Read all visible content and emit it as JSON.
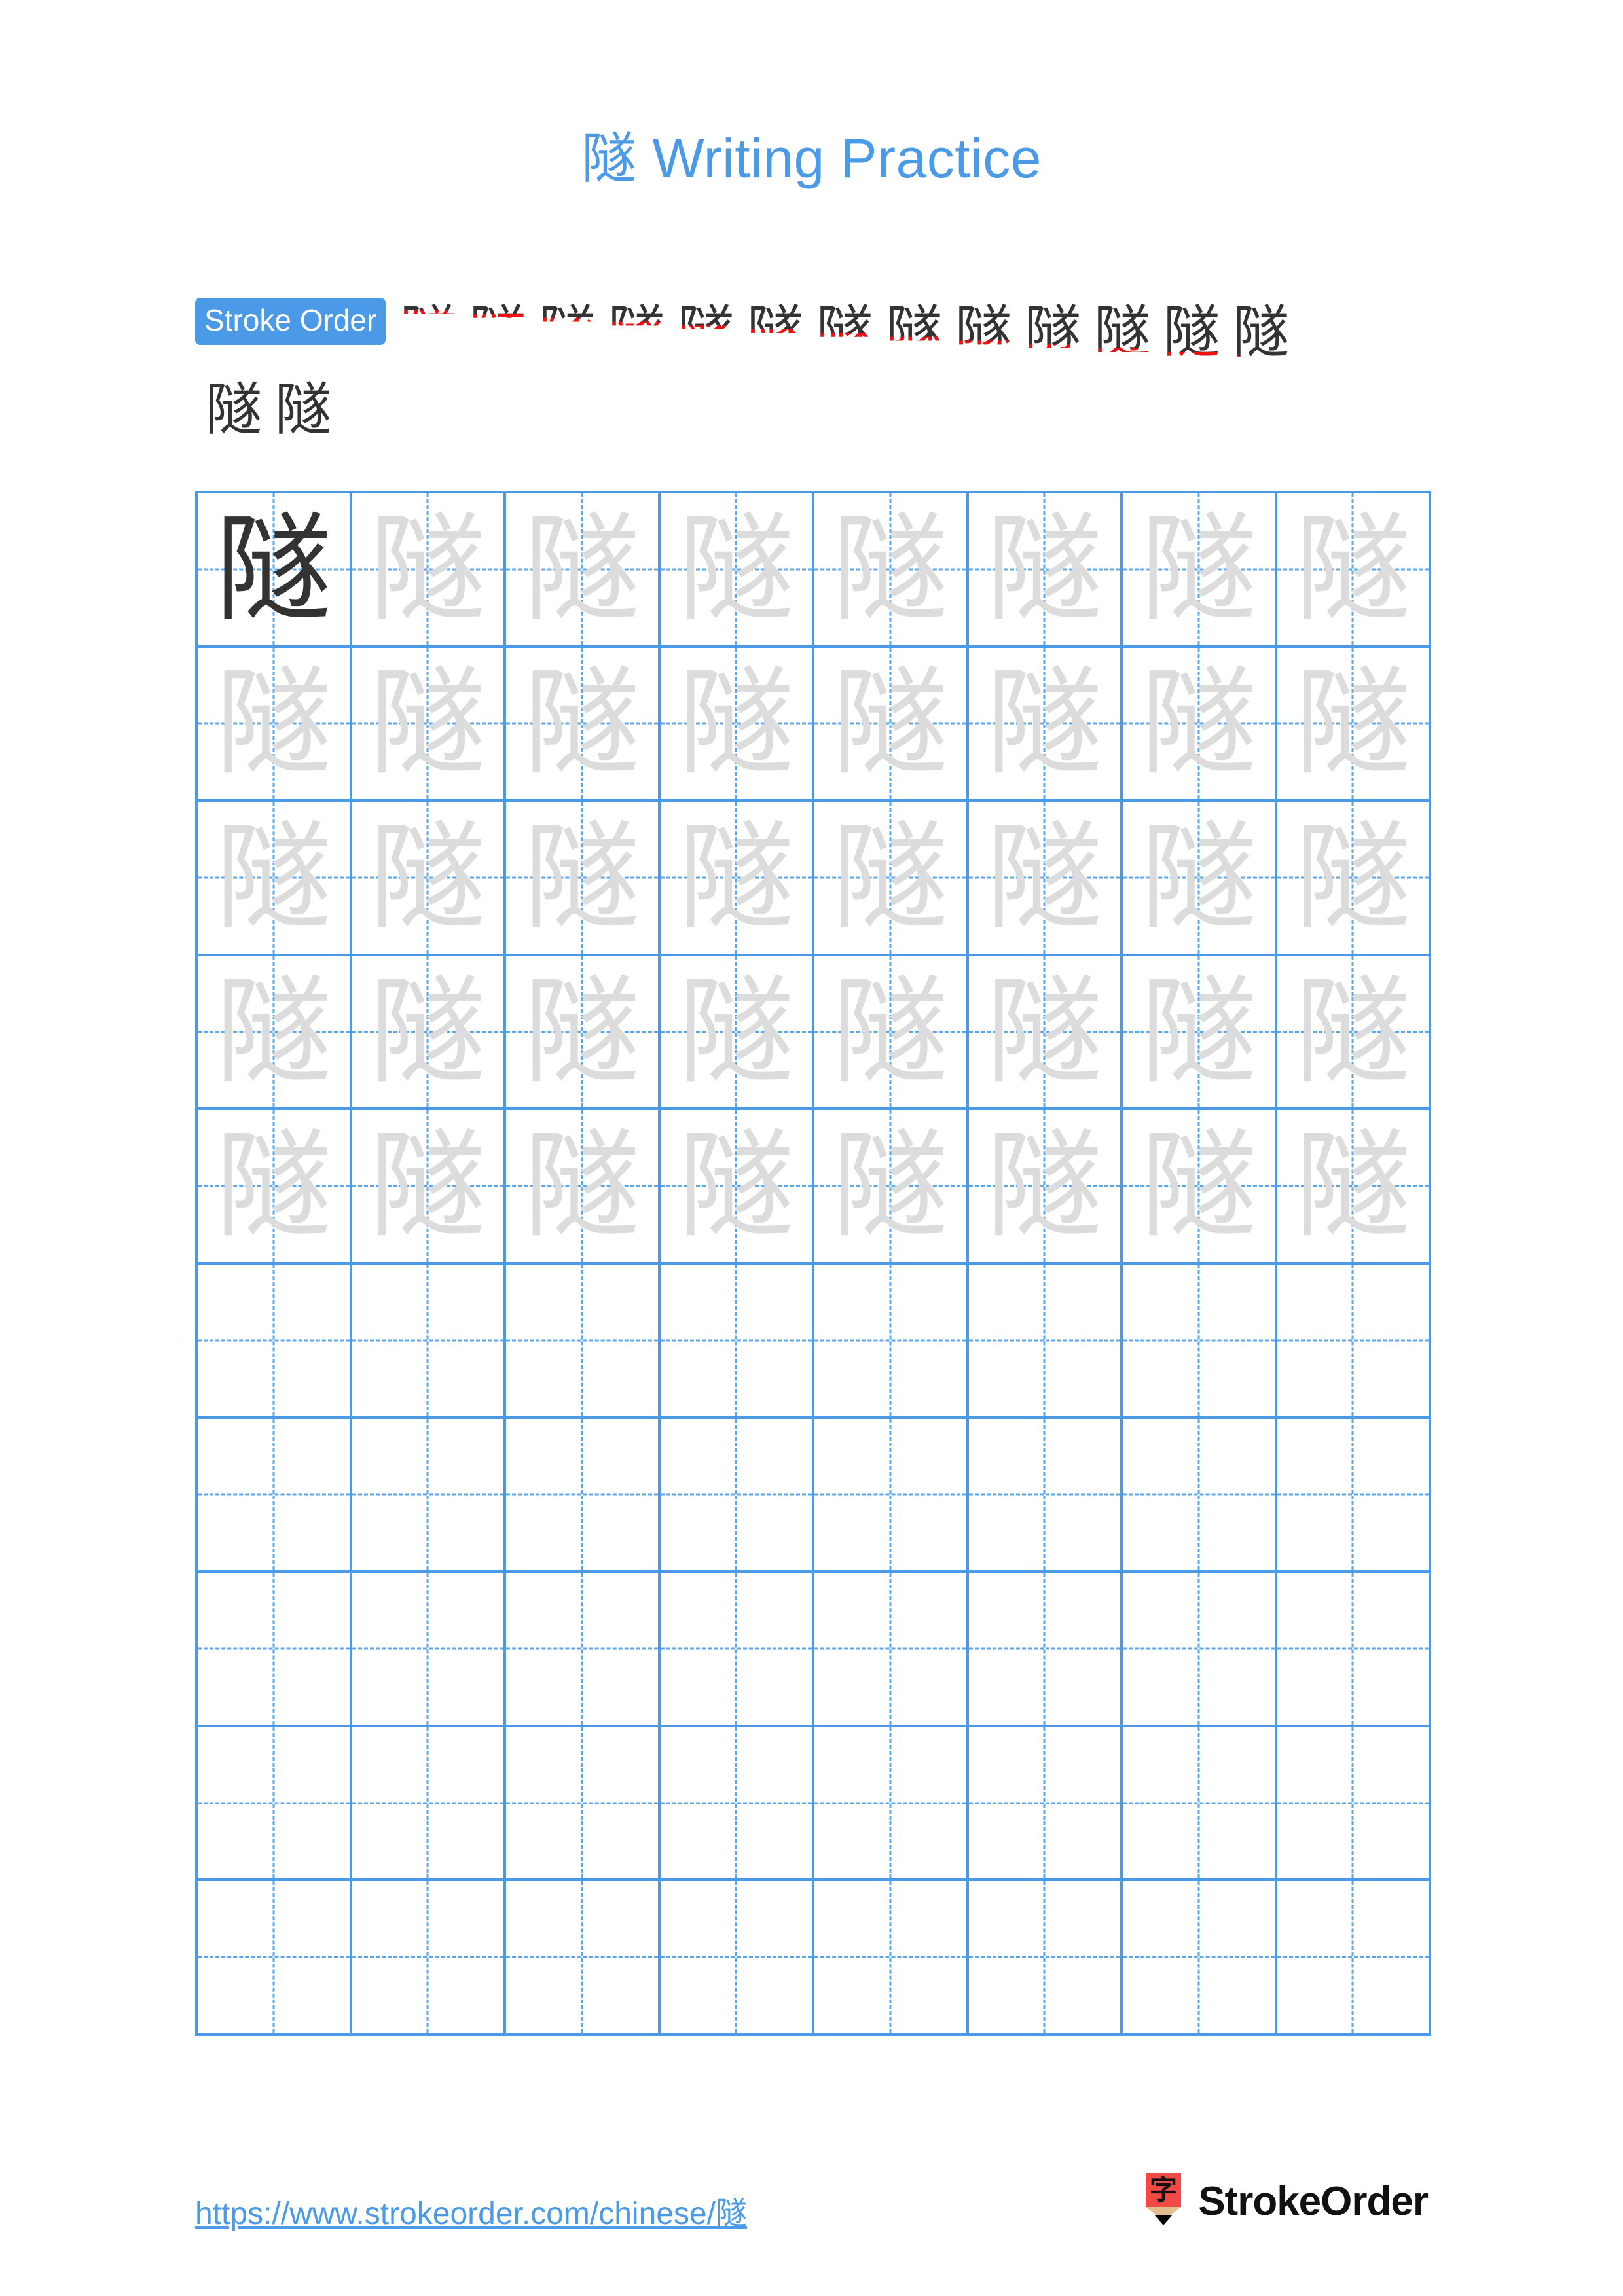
{
  "page": {
    "character": "隧",
    "background_color": "#ffffff",
    "accent_color": "#4a9ae8",
    "trace_color": "#dcdcdc",
    "ink_color": "#333333",
    "highlight_stroke_color": "#ee1111"
  },
  "header": {
    "title_character": "隧",
    "title_text": " Writing Practice",
    "title_full": "隧 Writing Practice",
    "title_color": "#4a9ae8"
  },
  "stroke_order": {
    "badge_label": "Stroke Order",
    "badge_bg": "#4a9ae8",
    "badge_text_color": "#ffffff",
    "total_strokes": 15,
    "row1_count": 13,
    "row2_count": 2,
    "steps": [
      {
        "index": 1,
        "partial": "乛",
        "new_stroke": "横折折折钩"
      },
      {
        "index": 2,
        "partial": "阝",
        "new_stroke": "竖"
      },
      {
        "index": 3,
        "partial": "阝丶",
        "new_stroke": "点"
      },
      {
        "index": 4,
        "partial": "阝丿",
        "new_stroke": "撇"
      },
      {
        "index": 5,
        "partial": "阝丷一",
        "new_stroke": "横"
      },
      {
        "index": 6,
        "partial": "阝丷丿",
        "new_stroke": "撇"
      },
      {
        "index": 7,
        "partial": "阝𫠠",
        "new_stroke": "横撇"
      },
      {
        "index": 8,
        "partial": "阝㒸",
        "new_stroke": "撇"
      },
      {
        "index": 9,
        "partial": "阝㒸丿",
        "new_stroke": "撇"
      },
      {
        "index": 10,
        "partial": "阝豕",
        "new_stroke": "撇"
      },
      {
        "index": 11,
        "partial": "隊",
        "new_stroke": "捺"
      },
      {
        "index": 12,
        "partial": "隊",
        "new_stroke": "点"
      },
      {
        "index": 13,
        "partial": "隊",
        "new_stroke": "点"
      },
      {
        "index": 14,
        "partial": "隧",
        "new_stroke": "点"
      },
      {
        "index": 15,
        "partial": "隧",
        "new_stroke": "平捺"
      }
    ]
  },
  "practice_grid": {
    "columns": 8,
    "rows": 10,
    "grid_line_color": "#4a9ae8",
    "guide_line_style": "dashed",
    "cells": [
      [
        "dark",
        "light",
        "light",
        "light",
        "light",
        "light",
        "light",
        "light"
      ],
      [
        "light",
        "light",
        "light",
        "light",
        "light",
        "light",
        "light",
        "light"
      ],
      [
        "light",
        "light",
        "light",
        "light",
        "light",
        "light",
        "light",
        "light"
      ],
      [
        "light",
        "light",
        "light",
        "light",
        "light",
        "light",
        "light",
        "light"
      ],
      [
        "light",
        "light",
        "light",
        "light",
        "light",
        "light",
        "light",
        "light"
      ],
      [
        "empty",
        "empty",
        "empty",
        "empty",
        "empty",
        "empty",
        "empty",
        "empty"
      ],
      [
        "empty",
        "empty",
        "empty",
        "empty",
        "empty",
        "empty",
        "empty",
        "empty"
      ],
      [
        "empty",
        "empty",
        "empty",
        "empty",
        "empty",
        "empty",
        "empty",
        "empty"
      ],
      [
        "empty",
        "empty",
        "empty",
        "empty",
        "empty",
        "empty",
        "empty",
        "empty"
      ],
      [
        "empty",
        "empty",
        "empty",
        "empty",
        "empty",
        "empty",
        "empty",
        "empty"
      ]
    ]
  },
  "footer": {
    "url": "https://www.strokeorder.com/chinese/隧",
    "url_color": "#4a9ae8",
    "brand_name": "StrokeOrder",
    "logo_character": "字",
    "logo_body_color": "#ef4a45",
    "logo_wood_color": "#e3bd8f",
    "logo_tip_color": "#000000"
  }
}
